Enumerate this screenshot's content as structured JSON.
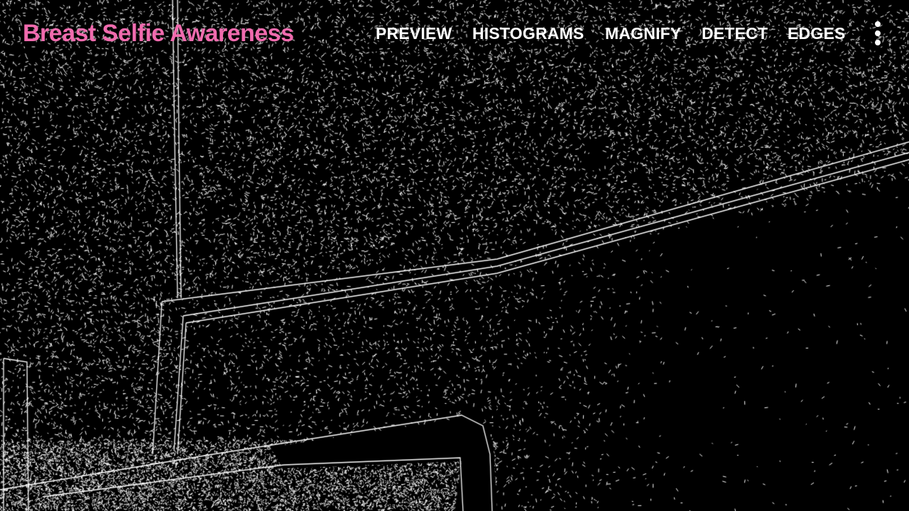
{
  "app": {
    "title": "Breast Selfie Awareness"
  },
  "menu": {
    "items": [
      {
        "label": "PREVIEW"
      },
      {
        "label": "HISTOGRAMS"
      },
      {
        "label": "MAGNIFY"
      },
      {
        "label": "DETECT"
      },
      {
        "label": "EDGES"
      }
    ],
    "overflow_icon": "more-vert-icon"
  },
  "camera_view": {
    "mode": "edges"
  },
  "colors": {
    "title": "#F06BAE",
    "menu_text": "#FFFFFF",
    "edges": "#FFFFFF",
    "background": "#000000"
  }
}
